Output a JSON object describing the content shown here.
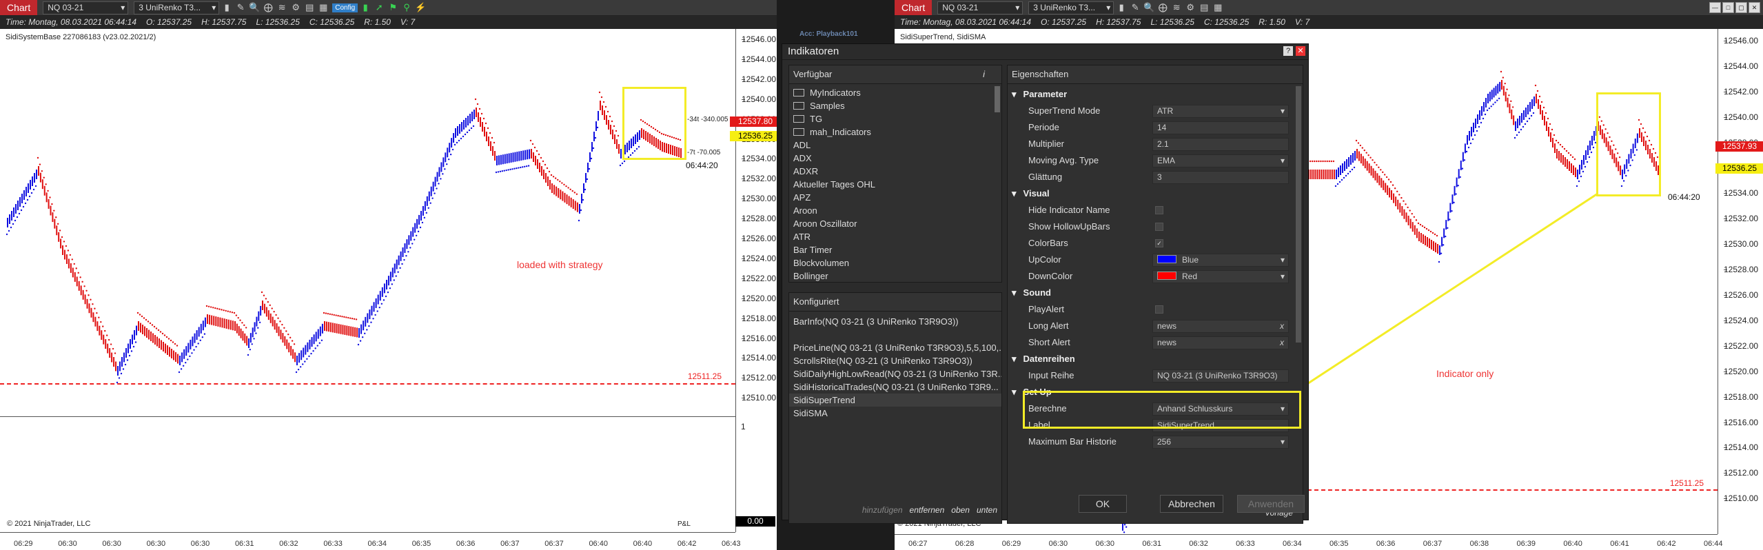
{
  "left": {
    "title": "Chart",
    "instrument": "NQ 03-21",
    "bars": "3 UniRenko T3...",
    "config_label": "Config",
    "ohlc": {
      "time": "Time: Montag, 08.03.2021 06:44:14",
      "open": "O: 12537.25",
      "high": "H: 12537.75",
      "low": "L: 12536.25",
      "close": "C: 12536.25",
      "range": "R: 1.50",
      "volume": "V: 7"
    },
    "study_label": "SidiSystemBase 227086183 (v23.02.2021/2)",
    "y_ticks": [
      "12546.00",
      "12544.00",
      "12542.00",
      "12540.00",
      "12538.00",
      "12536.00",
      "12534.00",
      "12532.00",
      "12530.00",
      "12528.00",
      "12526.00",
      "12524.00",
      "12522.00",
      "12520.00",
      "12518.00",
      "12516.00",
      "12514.00",
      "12512.00",
      "12510.00"
    ],
    "price_red": "12537.80",
    "price_yellow": "12536.25",
    "trade1": "-34t -340.005",
    "trade2": "-7t -70.005",
    "timer": "06:44:20",
    "stop_line": "12511.25",
    "note": "loaded with strategy",
    "sub_tick": "1",
    "pnl_label": "P&L",
    "pnl_value": "0.00",
    "copyright": "© 2021 NinjaTrader, LLC",
    "x_ticks": [
      "06:29",
      "06:30",
      "06:30",
      "06:30",
      "06:30",
      "06:31",
      "06:32",
      "06:33",
      "06:34",
      "06:35",
      "06:36",
      "06:37",
      "06:37",
      "06:40",
      "06:40",
      "06:42",
      "06:43"
    ]
  },
  "right": {
    "title": "Chart",
    "instrument": "NQ 03-21",
    "bars": "3 UniRenko T3...",
    "ohlc": {
      "time": "Time: Montag, 08.03.2021 06:44:14",
      "open": "O: 12537.25",
      "high": "H: 12537.75",
      "low": "L: 12536.25",
      "close": "C: 12536.25",
      "range": "R: 1.50",
      "volume": "V: 7"
    },
    "study_label": "SidiSuperTrend, SidiSMA",
    "y_ticks": [
      "12546.00",
      "12544.00",
      "12542.00",
      "12540.00",
      "12538.00",
      "12536.00",
      "12534.00",
      "12532.00",
      "12530.00",
      "12528.00",
      "12526.00",
      "12524.00",
      "12522.00",
      "12520.00",
      "12518.00",
      "12516.00",
      "12514.00",
      "12512.00",
      "12510.00"
    ],
    "price_red": "12537.93",
    "price_yellow": "12536.25",
    "timer": "06:44:20",
    "stop_line": "12511.25",
    "note": "Indicator only",
    "copyright": "© 2021 NinjaTrader, LLC",
    "x_ticks": [
      "06:27",
      "06:28",
      "06:29",
      "06:30",
      "06:30",
      "06:31",
      "06:32",
      "06:33",
      "06:34",
      "06:35",
      "06:36",
      "06:37",
      "06:38",
      "06:39",
      "06:40",
      "06:41",
      "06:42",
      "06:44"
    ]
  },
  "dialog": {
    "account_label": "Acc: Playback101",
    "title": "Indikatoren",
    "available_title": "Verfügbar",
    "available": [
      {
        "label": "MyIndicators",
        "folder": true
      },
      {
        "label": "Samples",
        "folder": true
      },
      {
        "label": "TG",
        "folder": true
      },
      {
        "label": "mah_Indicators",
        "folder": true
      },
      {
        "label": "ADL",
        "folder": false
      },
      {
        "label": "ADX",
        "folder": false
      },
      {
        "label": "ADXR",
        "folder": false
      },
      {
        "label": "Aktueller Tages OHL",
        "folder": false
      },
      {
        "label": "APZ",
        "folder": false
      },
      {
        "label": "Aroon",
        "folder": false
      },
      {
        "label": "Aroon Oszillator",
        "folder": false
      },
      {
        "label": "ATR",
        "folder": false
      },
      {
        "label": "Bar Timer",
        "folder": false
      },
      {
        "label": "Blockvolumen",
        "folder": false
      },
      {
        "label": "Bollinger",
        "folder": false
      }
    ],
    "configured_title": "Konfiguriert",
    "configured": [
      "BarInfo(NQ 03-21 (3 UniRenko T3R9O3))",
      "",
      "PriceLine(NQ 03-21 (3 UniRenko T3R9O3),5,5,100,...",
      "ScrollsRite(NQ 03-21 (3 UniRenko T3R9O3))",
      "SidiDailyHighLowRead(NQ 03-21 (3 UniRenko T3R...",
      "SidiHistoricalTrades(NQ 03-21 (3 UniRenko T3R9...",
      "SidiSuperTrend",
      "SidiSMA"
    ],
    "actions": {
      "add": "hinzufügen",
      "remove": "entfernen",
      "up": "oben",
      "down": "unten"
    },
    "props_title": "Eigenschaften",
    "categories": [
      {
        "name": "Parameter",
        "rows": [
          {
            "k": "SuperTrend Mode",
            "v": "ATR",
            "type": "dd"
          },
          {
            "k": "Periode",
            "v": "14",
            "type": "text"
          },
          {
            "k": "Multiplier",
            "v": "2.1",
            "type": "text"
          },
          {
            "k": "Moving Avg. Type",
            "v": "EMA",
            "type": "dd"
          },
          {
            "k": "Glättung",
            "v": "3",
            "type": "text"
          }
        ]
      },
      {
        "name": "Visual",
        "rows": [
          {
            "k": "Hide Indicator Name",
            "v": "",
            "type": "cb"
          },
          {
            "k": "Show HollowUpBars",
            "v": "",
            "type": "cb"
          },
          {
            "k": "ColorBars",
            "v": "✓",
            "type": "cb"
          },
          {
            "k": "UpColor",
            "v": "Blue",
            "type": "color",
            "color": "#0000ff"
          },
          {
            "k": "DownColor",
            "v": "Red",
            "type": "color",
            "color": "#ff0000"
          }
        ]
      },
      {
        "name": "Sound",
        "rows": [
          {
            "k": "PlayAlert",
            "v": "",
            "type": "cb"
          },
          {
            "k": "Long Alert",
            "v": "news",
            "type": "x"
          },
          {
            "k": "Short Alert",
            "v": "news",
            "type": "x"
          }
        ]
      },
      {
        "name": "Datenreihen",
        "rows": [
          {
            "k": "Input Reihe",
            "v": "NQ 03-21 (3 UniRenko T3R9O3)",
            "type": "text"
          }
        ]
      },
      {
        "name": "Set Up",
        "rows": [
          {
            "k": "Berechne",
            "v": "Anhand Schlusskurs",
            "type": "dd"
          },
          {
            "k": "Label",
            "v": "SidiSuperTrend",
            "type": "text"
          },
          {
            "k": "Maximum Bar Historie",
            "v": "256",
            "type": "dd"
          }
        ]
      }
    ],
    "template_label": "Vorlage",
    "ok": "OK",
    "cancel": "Abbrechen",
    "apply": "Anwenden"
  },
  "colors": {
    "up": "#1010e0",
    "down": "#e01010",
    "highlight": "#f3ec27"
  }
}
